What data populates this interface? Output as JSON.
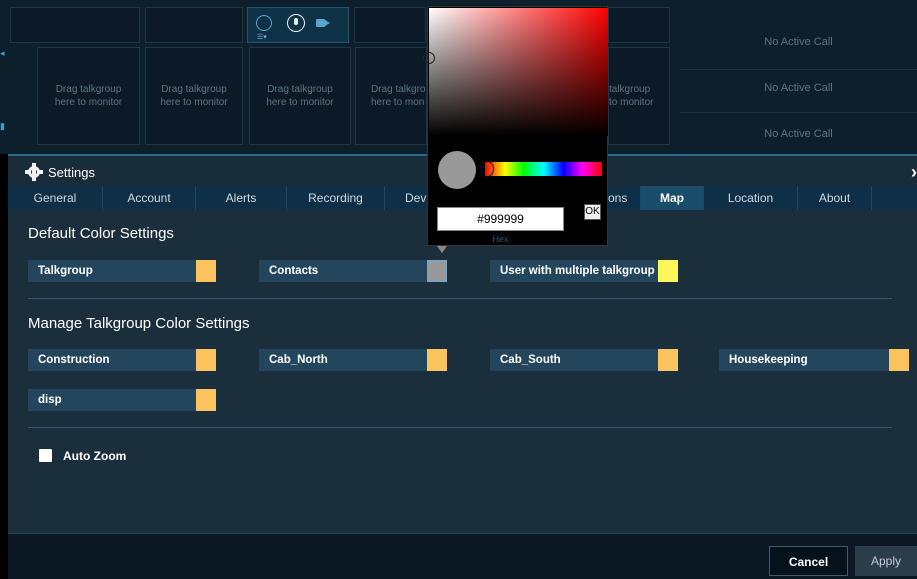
{
  "monitor": {
    "cells": [
      {
        "line1": "Drag talkgroup",
        "line2": "here to monitor"
      },
      {
        "line1": "Drag talkgroup",
        "line2": "here to monitor"
      },
      {
        "line1": "Drag talkgroup",
        "line2": "here to monitor"
      },
      {
        "line1": "Drag talkgro",
        "line2": "here to mon"
      },
      {
        "line1": "talkgroup",
        "line2": "to monitor"
      }
    ],
    "active_icons": [
      "circle-icon",
      "list-icon",
      "mic-icon",
      "video-icon"
    ],
    "calls": [
      "No Active Call",
      "No Active Call",
      "No Active Call"
    ]
  },
  "settings": {
    "title": "Settings",
    "tabs": [
      {
        "label": "General"
      },
      {
        "label": "Account"
      },
      {
        "label": "Alerts"
      },
      {
        "label": "Recording"
      },
      {
        "label": "Dev"
      },
      {
        "label": "ons"
      },
      {
        "label": "Map",
        "active": true
      },
      {
        "label": "Location"
      },
      {
        "label": "About"
      }
    ],
    "default_heading": "Default Color Settings",
    "default_rows": [
      {
        "label": "Talkgroup",
        "color": "#fdc35f"
      },
      {
        "label": "Contacts",
        "color": "#999999"
      },
      {
        "label": "User with multiple talkgroup",
        "color": "#fff65a"
      }
    ],
    "manage_heading": "Manage Talkgroup Color Settings",
    "manage_rows": [
      {
        "label": "Construction",
        "color": "#fdc35f"
      },
      {
        "label": "Cab_North",
        "color": "#fdc35f"
      },
      {
        "label": "Cab_South",
        "color": "#fdc35f"
      },
      {
        "label": "Housekeeping",
        "color": "#fdc35f"
      },
      {
        "label": "disp",
        "color": "#fdc35f"
      }
    ],
    "auto_zoom_label": "Auto Zoom",
    "auto_zoom_checked": false,
    "cancel_label": "Cancel",
    "apply_label": "Apply"
  },
  "picker": {
    "hex_value": "#999999",
    "hex_label": "Hex",
    "ok_label": "OK",
    "preview_color": "#999999"
  }
}
